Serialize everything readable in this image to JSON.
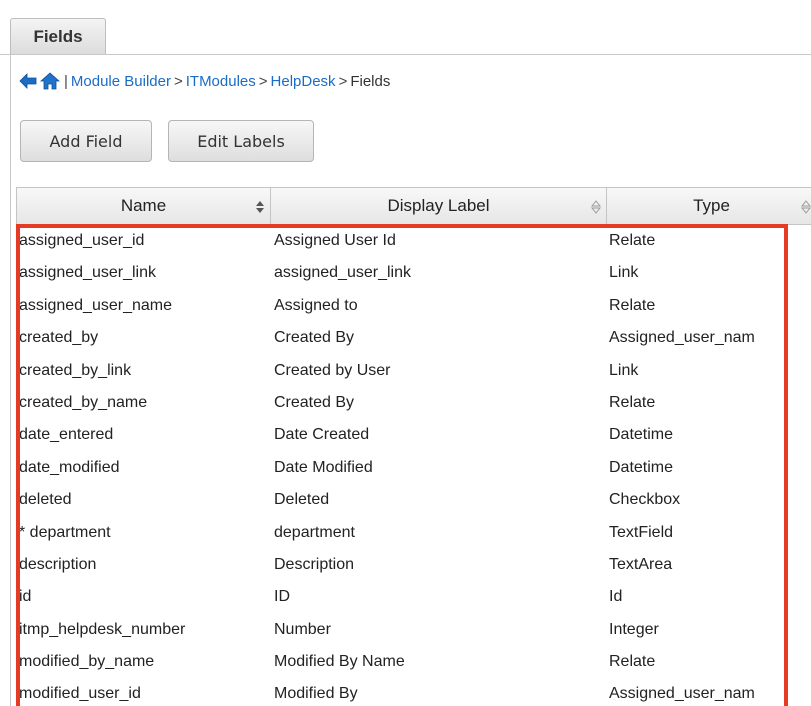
{
  "tabs": {
    "active": "Fields"
  },
  "breadcrumb": {
    "items": [
      "Module Builder",
      "ITModules",
      "HelpDesk"
    ],
    "current": "Fields",
    "separator": ">",
    "divider": "|"
  },
  "toolbar": {
    "add_field": "Add Field",
    "edit_labels": "Edit Labels"
  },
  "table": {
    "columns": [
      "Name",
      "Display Label",
      "Type"
    ],
    "rows": [
      [
        "assigned_user_id",
        "Assigned User Id",
        "Relate"
      ],
      [
        "assigned_user_link",
        "assigned_user_link",
        "Link"
      ],
      [
        "assigned_user_name",
        "Assigned to",
        "Relate"
      ],
      [
        "created_by",
        "Created By",
        "Assigned_user_nam"
      ],
      [
        "created_by_link",
        "Created by User",
        "Link"
      ],
      [
        "created_by_name",
        "Created By",
        "Relate"
      ],
      [
        "date_entered",
        "Date Created",
        "Datetime"
      ],
      [
        "date_modified",
        "Date Modified",
        "Datetime"
      ],
      [
        "deleted",
        "Deleted",
        "Checkbox"
      ],
      [
        "* department",
        "department",
        "TextField"
      ],
      [
        "description",
        "Description",
        "TextArea"
      ],
      [
        "id",
        "ID",
        "Id"
      ],
      [
        "itmp_helpdesk_number",
        "Number",
        "Integer"
      ],
      [
        "modified_by_name",
        "Modified By Name",
        "Relate"
      ],
      [
        "modified_user_id",
        "Modified By",
        "Assigned_user_nam"
      ]
    ]
  },
  "colors": {
    "link": "#1a6cc6",
    "highlight": "#e53a24",
    "back_arrow": "#1a6cc6",
    "home_icon": "#1f73c9"
  },
  "icons": [
    "back-arrow-icon",
    "home-icon",
    "sort-icon"
  ]
}
